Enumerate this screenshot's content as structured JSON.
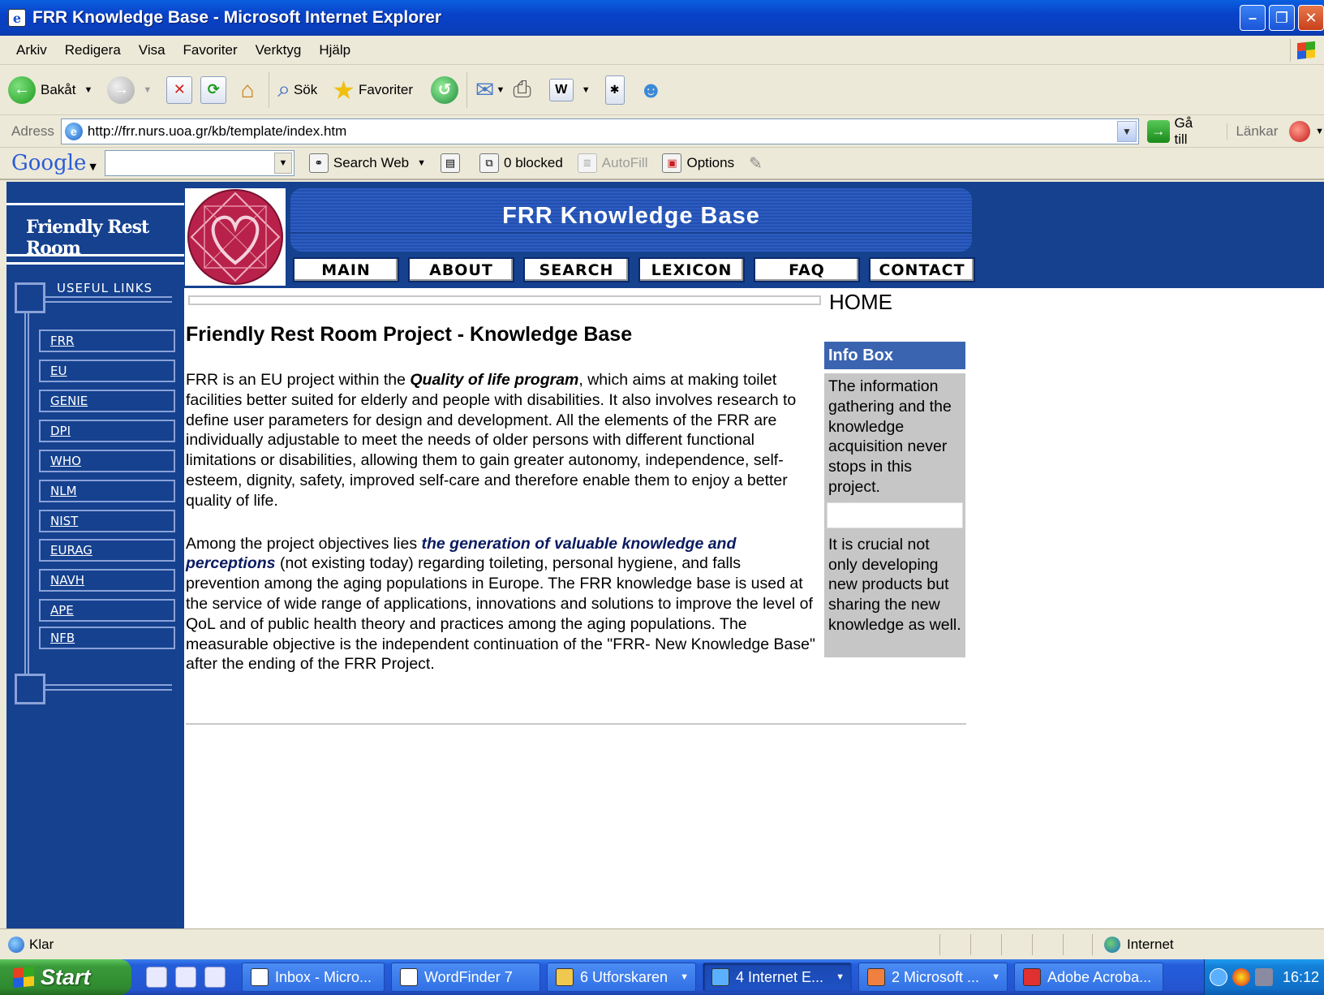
{
  "window": {
    "title": "FRR Knowledge Base - Microsoft Internet Explorer"
  },
  "menubar": [
    "Arkiv",
    "Redigera",
    "Visa",
    "Favoriter",
    "Verktyg",
    "Hjälp"
  ],
  "toolbar": {
    "back_label": "Bakåt",
    "search_label": "Sök",
    "favorites_label": "Favoriter"
  },
  "address": {
    "label": "Adress",
    "url": "http://frr.nurs.uoa.gr/kb/template/index.htm",
    "go_label": "Gå till",
    "links_label": "Länkar"
  },
  "googlebar": {
    "logo": "Google",
    "search_web_label": "Search Web",
    "blocked_label": "0 blocked",
    "autofill_label": "AutoFill",
    "options_label": "Options"
  },
  "site": {
    "brand": "Friendly Rest Room",
    "banner_title": "FRR  Knowledge  Base",
    "nav": [
      "MAIN",
      "ABOUT",
      "SEARCH",
      "LEXICON",
      "FAQ",
      "CONTACT"
    ],
    "useful_links_title": "USEFUL LINKS",
    "useful_links": [
      "FRR",
      "EU",
      "GENIE",
      "DPI",
      "WHO",
      "NLM",
      "NIST",
      "EURAG",
      "NAVH",
      "APE",
      "NFB"
    ],
    "home_label": "HOME",
    "content_title": "Friendly Rest Room Project - Knowledge Base",
    "p1_before": "FRR is an EU project within the ",
    "p1_em": "Quality of life program",
    "p1_after": ", which aims at making toilet facilities better suited for elderly and people with disabilities. It also involves research to define user parameters for design and development. All the elements of the FRR are individually adjustable to meet the needs of older persons with different functional limitations or disabilities, allowing them to gain greater autonomy, independence, self-esteem, dignity, safety, improved self-care and therefore enable them to enjoy a better quality of life.",
    "p2_before": "Among the project objectives lies ",
    "p2_em": "the generation of valuable knowledge and perceptions",
    "p2_after": " (not existing today) regarding toileting, personal hygiene, and falls prevention among the aging populations in Europe. The FRR knowledge base is used at the service of wide range of applications, innovations and solutions to improve the level of QoL and of public health theory and practices among the aging populations. The measurable objective is the independent continuation of the \"FRR- New Knowledge Base\" after the ending of the FRR Project.",
    "infobox_title": "Info Box",
    "infobox_text1": "The information gathering and the knowledge acquisition never stops in this project.",
    "infobox_text2": "It is crucial not only developing new products but sharing the new knowledge as well."
  },
  "statusbar": {
    "status": "Klar",
    "zone": "Internet"
  },
  "taskbar": {
    "start_label": "Start",
    "tasks": [
      "Inbox - Micro...",
      "WordFinder 7",
      "6 Utforskaren",
      "4 Internet E...",
      "2 Microsoft ...",
      "Adobe Acroba..."
    ],
    "clock": "16:12"
  }
}
